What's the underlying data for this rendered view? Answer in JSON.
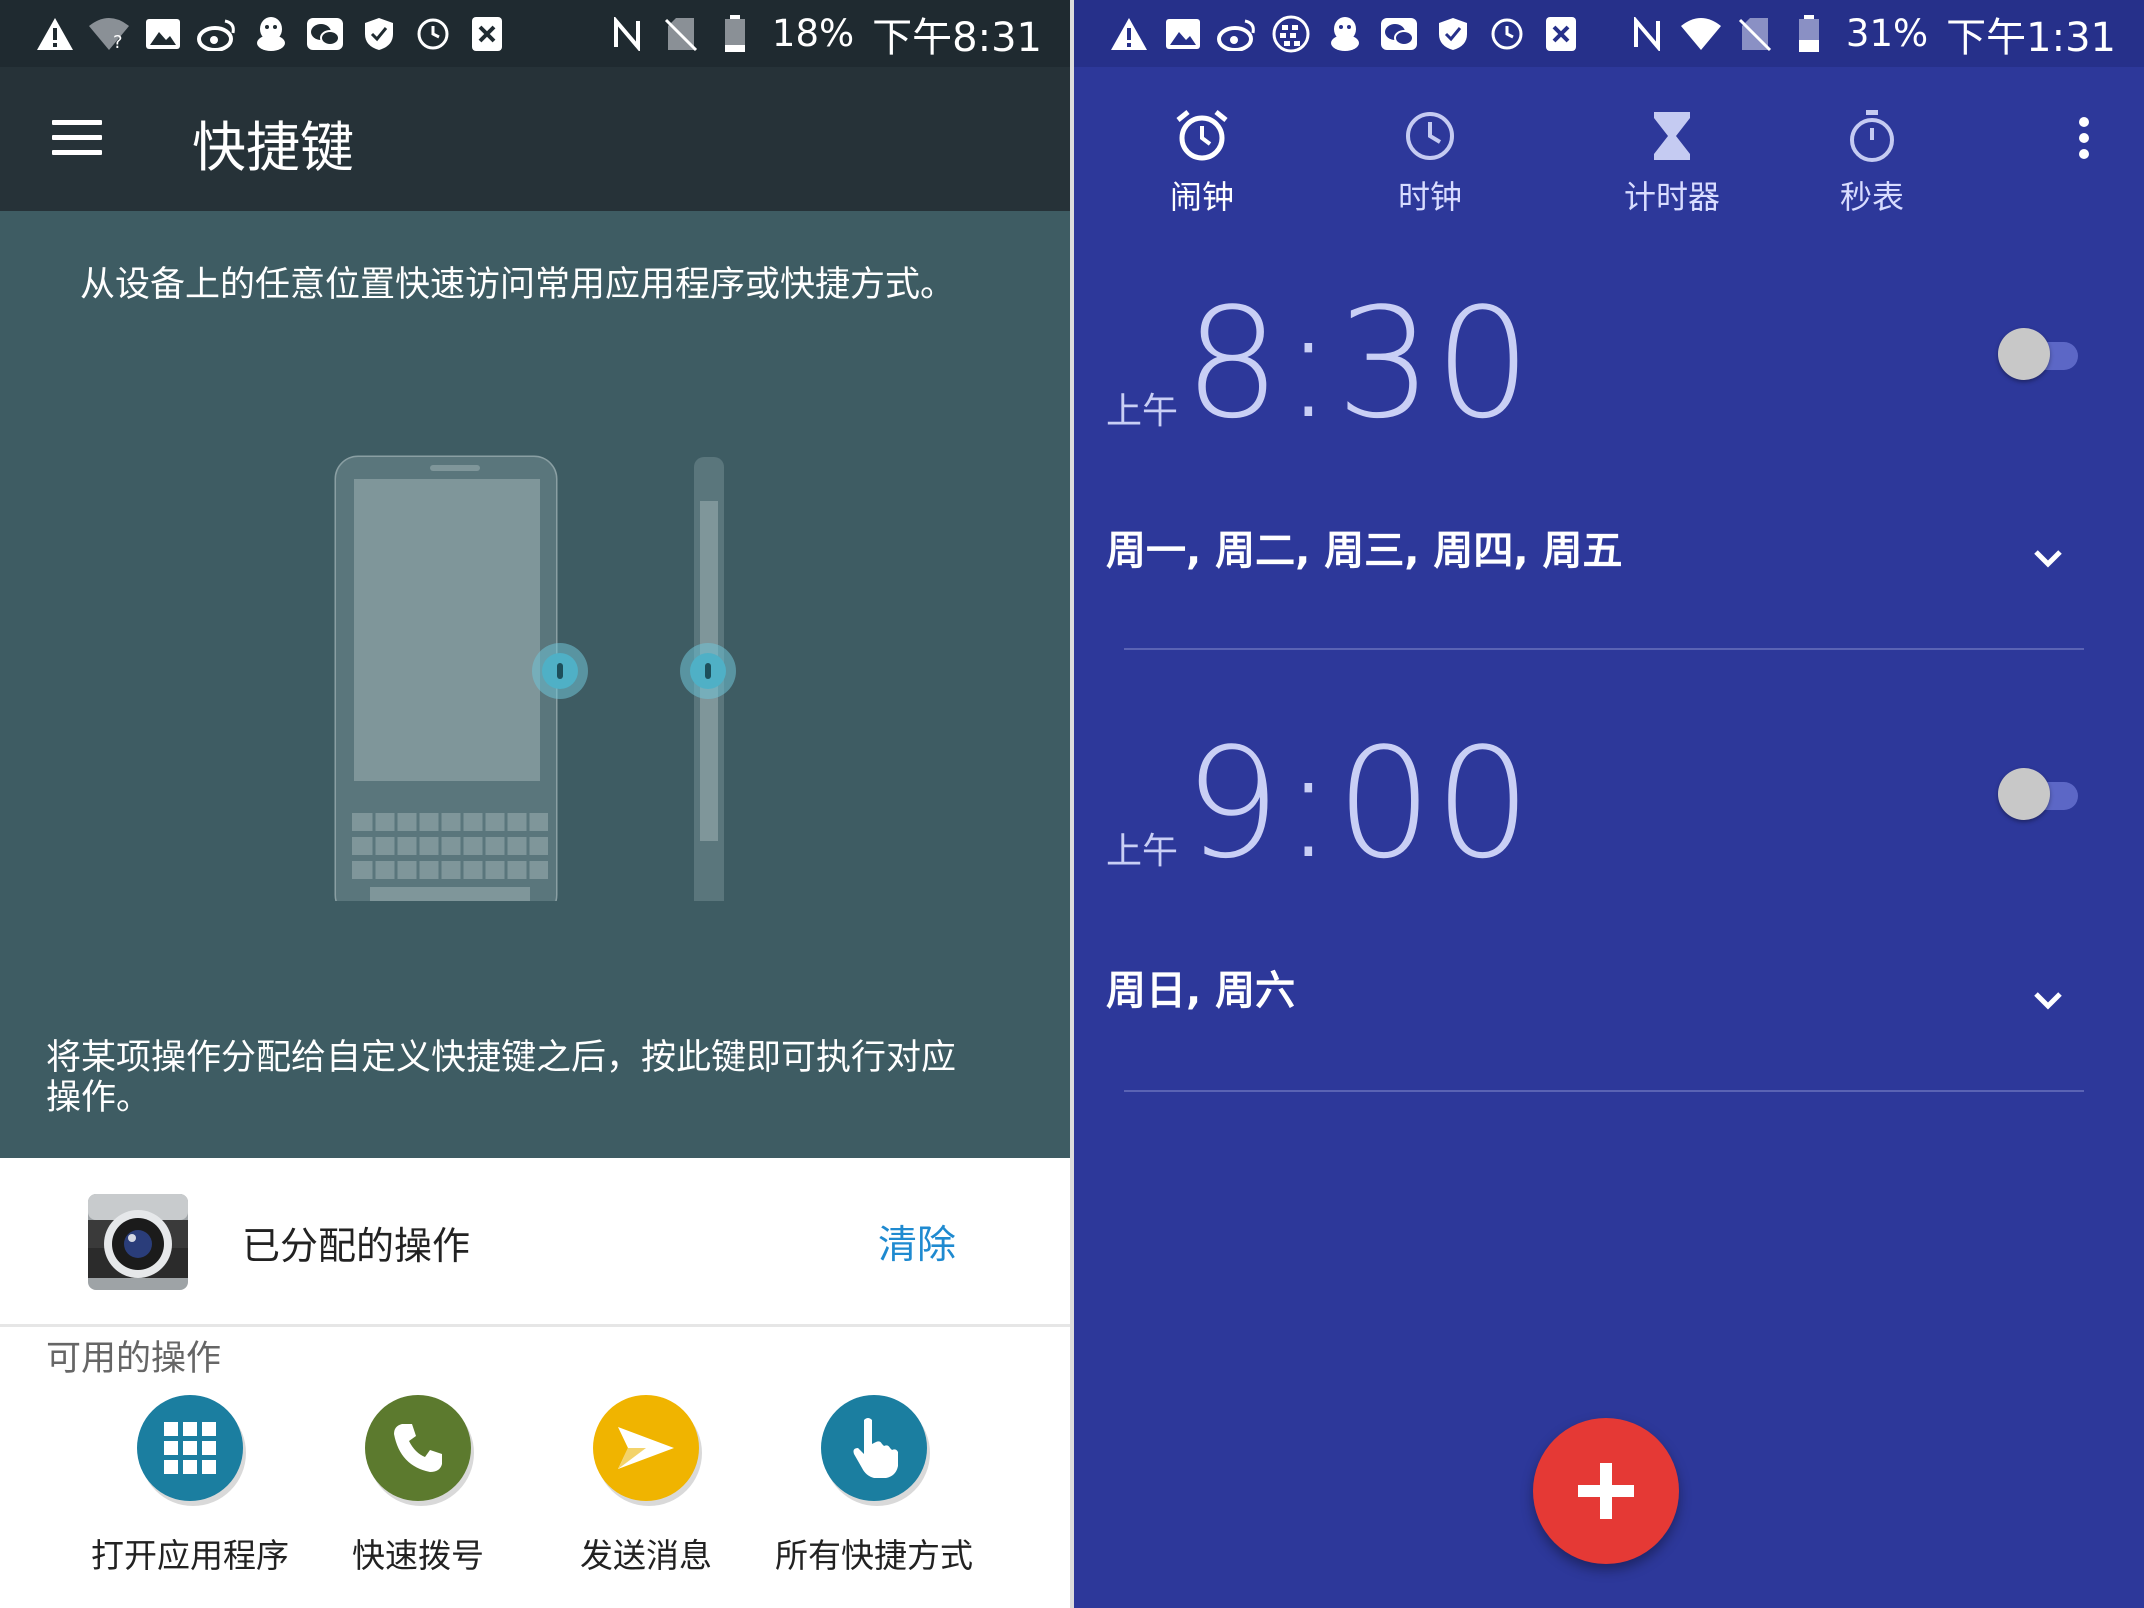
{
  "left": {
    "status": {
      "battery": "18%",
      "time": "下午8:31"
    },
    "app_title": "快捷键",
    "intro": "从设备上的任意位置快速访问常用应用程序或快捷方式。",
    "instruction_line1": "将某项操作分配给自定义快捷键之后，按此键即可执行对应",
    "instruction_line2": "操作。",
    "assigned_label": "已分配的操作",
    "clear_label": "清除",
    "available_heading": "可用的操作",
    "actions": [
      {
        "label": "打开应用程序",
        "icon": "app-grid-icon",
        "color": "#1b7ea0"
      },
      {
        "label": "快速拨号",
        "icon": "phone-icon",
        "color": "#5c7a2e"
      },
      {
        "label": "发送消息",
        "icon": "send-icon",
        "color": "#f0b400"
      },
      {
        "label": "所有快捷方式",
        "icon": "tap-hand-icon",
        "color": "#1b7ea0"
      }
    ]
  },
  "right": {
    "status": {
      "battery": "31%",
      "time": "下午1:31"
    },
    "tabs": [
      {
        "label": "闹钟",
        "icon": "alarm-icon"
      },
      {
        "label": "时钟",
        "icon": "clock-icon"
      },
      {
        "label": "计时器",
        "icon": "hourglass-icon"
      },
      {
        "label": "秒表",
        "icon": "stopwatch-icon"
      }
    ],
    "alarms": [
      {
        "ampm": "上午",
        "time": "8:30",
        "days": "周一, 周二, 周三, 周四, 周五",
        "enabled": false
      },
      {
        "ampm": "上午",
        "time": "9:00",
        "days": "周日, 周六",
        "enabled": false
      }
    ],
    "colors": {
      "background": "#2d389a",
      "fab": "#e53935"
    }
  }
}
